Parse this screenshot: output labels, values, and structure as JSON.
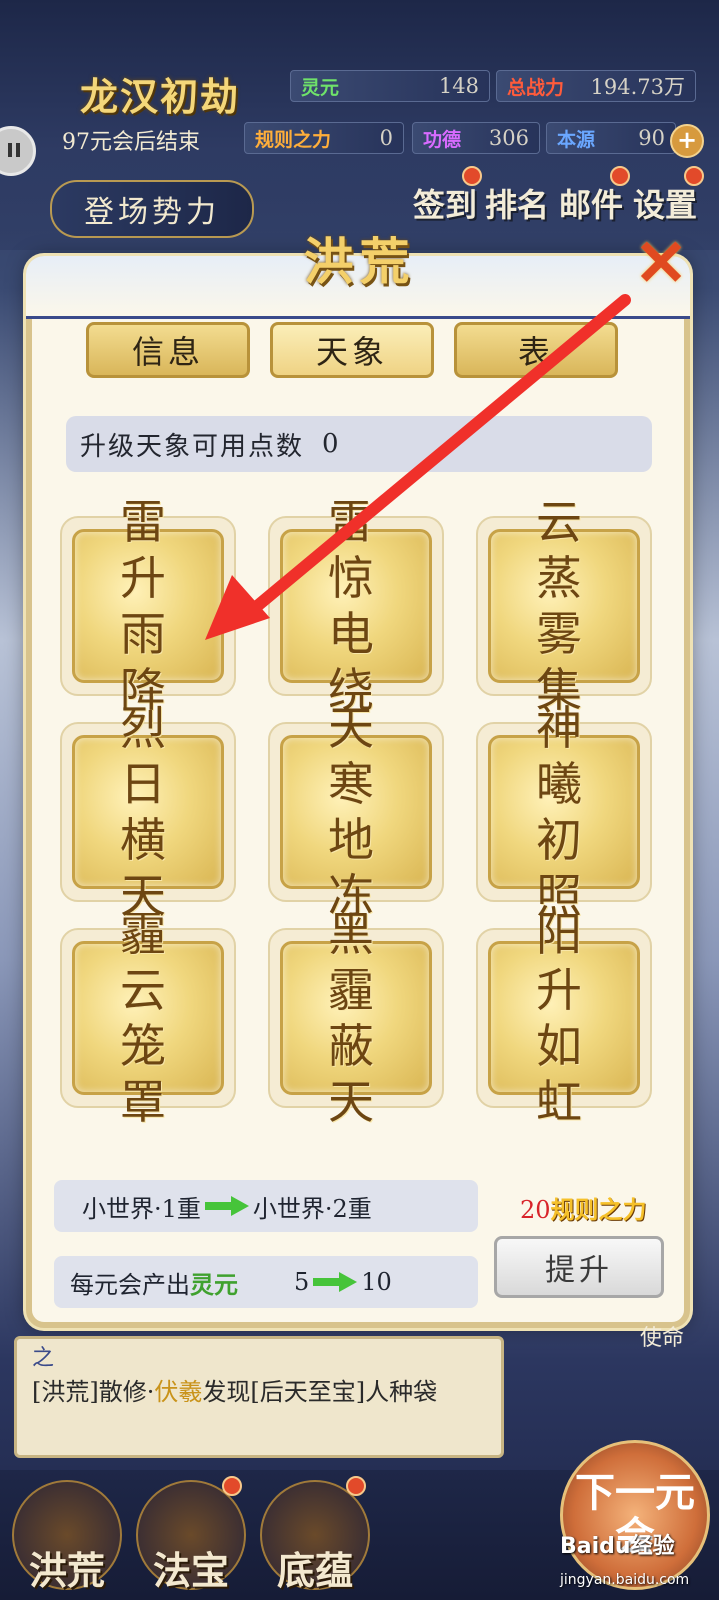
{
  "hud": {
    "world_title": "龙汉初劫",
    "end_text": "97元会后结束",
    "stats": [
      {
        "label": "灵元",
        "value": "148",
        "color": "#6fe36a"
      },
      {
        "label": "总战力",
        "value": "194.73万",
        "color": "#ff5b3b"
      },
      {
        "label": "规则之力",
        "value": "0",
        "color": "#ffae3a"
      },
      {
        "label": "功德",
        "value": "306",
        "color": "#d86bff"
      },
      {
        "label": "本源",
        "value": "90",
        "color": "#6aa7ff"
      }
    ],
    "plus_icon": "plus-icon",
    "faction_button": "登场势力",
    "menu": [
      {
        "label": "签到",
        "has_dot": true
      },
      {
        "label": "排名",
        "has_dot": false
      },
      {
        "label": "邮件",
        "has_dot": true
      },
      {
        "label": "设置",
        "has_dot": true
      }
    ]
  },
  "panel": {
    "title": "洪荒",
    "close_icon": "close-x-icon",
    "tabs": [
      {
        "label": "信息",
        "active": false
      },
      {
        "label": "天象",
        "active": true
      },
      {
        "label": "表"
      }
    ],
    "points_label": "升级天象可用点数",
    "points_value": "0",
    "skills": [
      "雷升雨降",
      "雷惊电绕",
      "云蒸雾集",
      "烈日横天",
      "天寒地冻",
      "神曦初照",
      "霾云笼罩",
      "黑霾蔽天",
      "阳升如虹"
    ],
    "level_from": "小世界·1重",
    "level_to": "小世界·2重",
    "output_prefix": "每元会产出",
    "output_resource": "灵元",
    "output_from": "5",
    "output_to": "10",
    "cost_amount": "20",
    "cost_resource": "规则之力",
    "upgrade_button": "提升"
  },
  "log": {
    "line_prefix": "[洪荒]散修·",
    "line_highlight": "伏羲",
    "line_suffix": "发现[后天至宝]人种袋",
    "top_fragment": "之"
  },
  "side_button": "使命",
  "bottom_nav": [
    {
      "label": "洪荒"
    },
    {
      "label": "法宝"
    },
    {
      "label": "底蕴"
    }
  ],
  "next_button": "下一元会",
  "watermark": {
    "brand": "Baidu经验",
    "url": "jingyan.baidu.com"
  },
  "annotation": {
    "color": "#f0302a"
  }
}
